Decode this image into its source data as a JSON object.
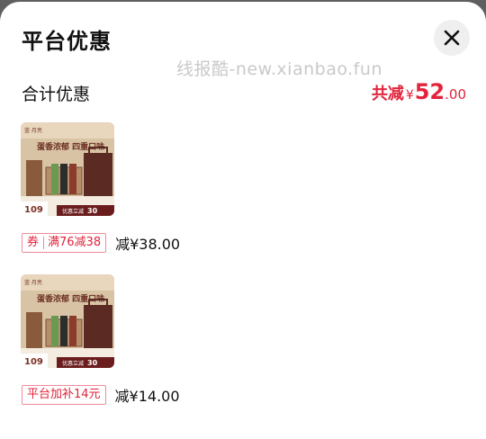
{
  "sheet": {
    "title": "平台优惠",
    "close_icon": "close-icon",
    "watermark": "线报酷-new.xianbao.fun"
  },
  "summary": {
    "label": "合计优惠",
    "prefix": "共减",
    "currency": "¥",
    "integer": "52",
    "decimal": ".00"
  },
  "items": [
    {
      "image": {
        "brand": "蓝·月亮",
        "headline": "蛋香浓郁 四重口味",
        "price": "109",
        "cta": "优惠立减",
        "cta_amount": "30"
      },
      "tag_type": "券",
      "tag_text": "满76减38",
      "reduce_text": "减¥38.00"
    },
    {
      "image": {
        "brand": "蓝·月亮",
        "headline": "蛋香浓郁 四重口味",
        "price": "109",
        "cta": "优惠立减",
        "cta_amount": "30"
      },
      "tag_text": "平台加补14元",
      "reduce_text": "减¥14.00"
    }
  ],
  "colors": {
    "accent": "#e2233b",
    "overlay": "#5f5f5f"
  }
}
